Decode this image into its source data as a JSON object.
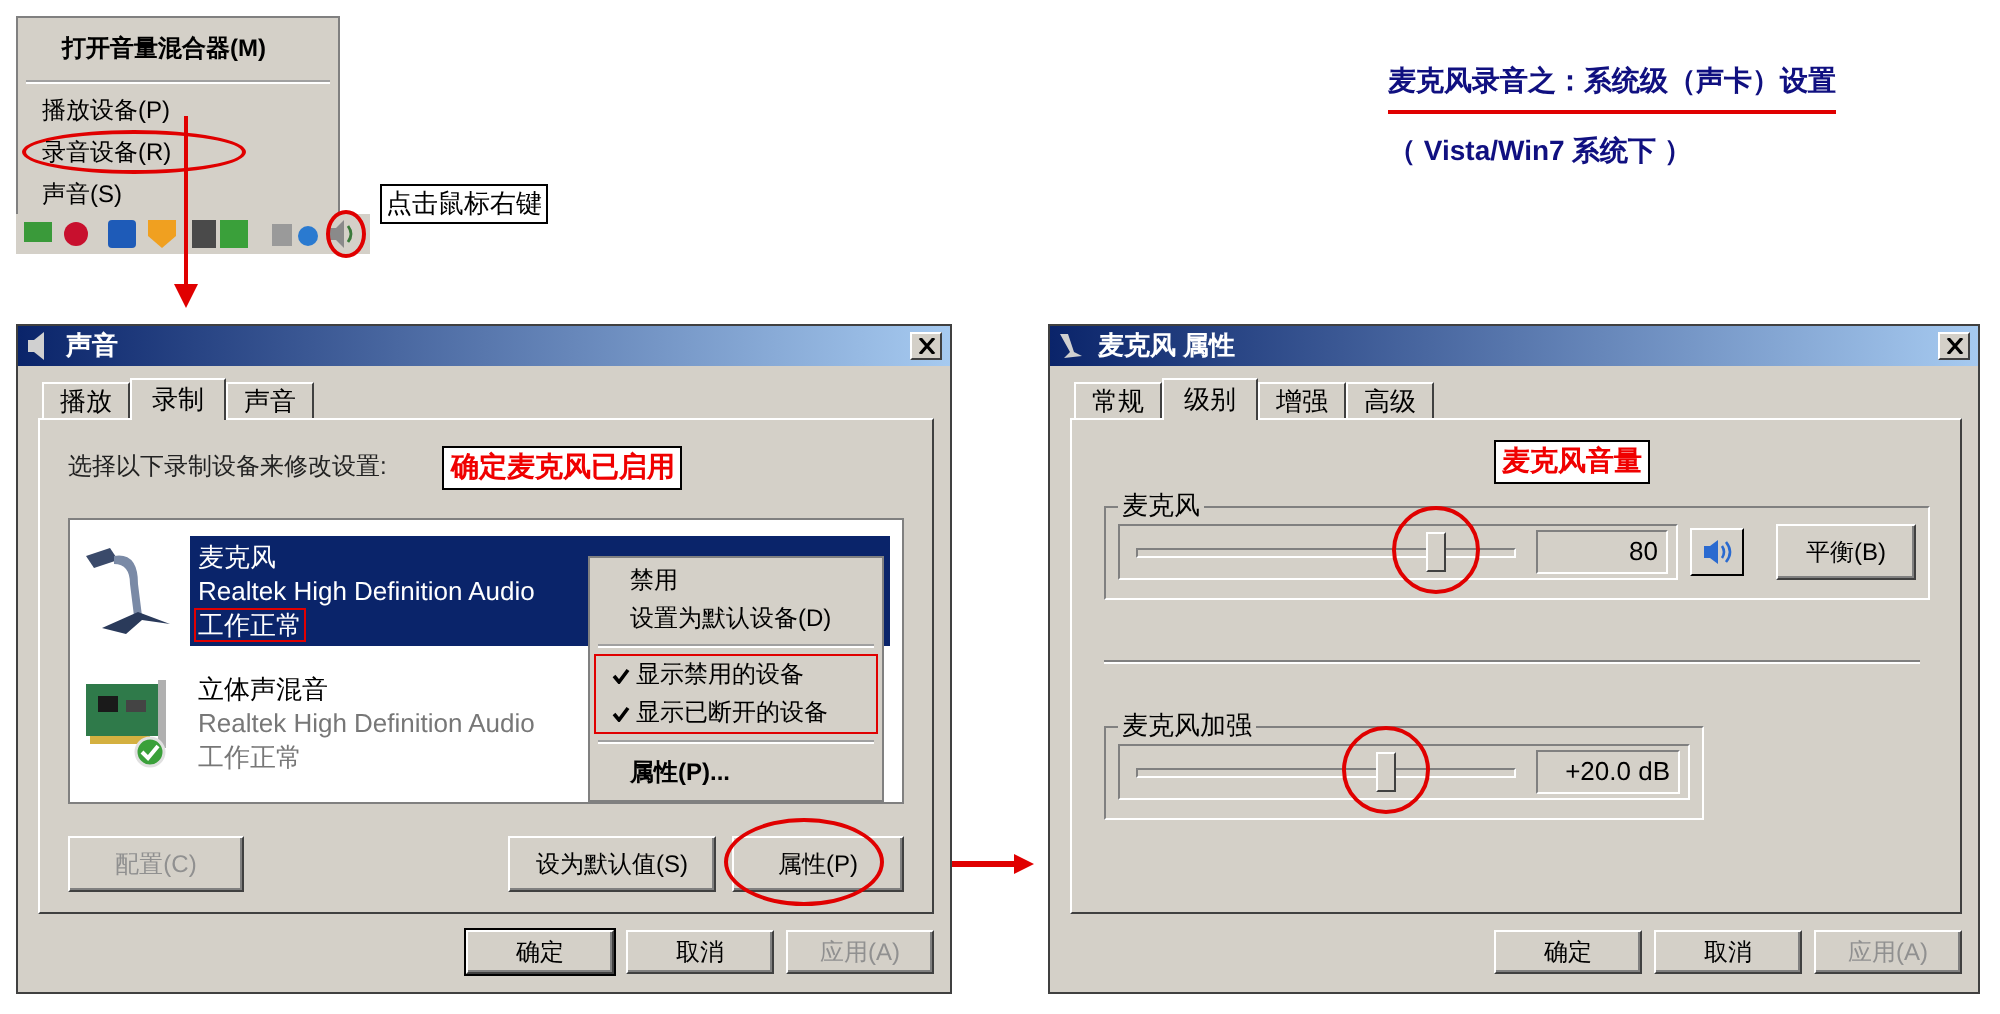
{
  "heading": {
    "title": "麦克风录音之：系统级（声卡）设置",
    "subtitle": "（ Vista/Win7 系统下 ）"
  },
  "tray": {
    "menu": [
      {
        "label": "打开音量混合器(M)",
        "kind": "header",
        "circled": false
      },
      {
        "label": "播放设备(P)",
        "kind": "item",
        "circled": false
      },
      {
        "label": "录音设备(R)",
        "kind": "item",
        "circled": true
      },
      {
        "label": "声音(S)",
        "kind": "item",
        "circled": false
      }
    ],
    "hint": "点击鼠标右键"
  },
  "sound_window": {
    "title": "声音",
    "tabs": [
      {
        "label": "播放",
        "selected": false
      },
      {
        "label": "录制",
        "selected": true
      },
      {
        "label": "声音",
        "selected": false
      }
    ],
    "instruction": "选择以下录制设备来修改设置:",
    "callout": "确定麦克风已启用",
    "devices": [
      {
        "kind": "microphone",
        "name": "麦克风",
        "driver": "Realtek High Definition Audio",
        "status": "工作正常",
        "selected": true,
        "status_boxed": true
      },
      {
        "kind": "sound-card",
        "name": "立体声混音",
        "driver": "Realtek High Definition Audio",
        "status": "工作正常",
        "selected": false,
        "status_boxed": false
      }
    ],
    "context_menu": {
      "items": [
        {
          "label": "禁用"
        },
        {
          "label": "设置为默认设备(D)"
        }
      ],
      "checks": {
        "boxed": true,
        "items": [
          {
            "label": "显示禁用的设备",
            "checked": true
          },
          {
            "label": "显示已断开的设备",
            "checked": true
          }
        ]
      },
      "last": {
        "label": "属性(P)..."
      }
    },
    "buttons": [
      {
        "label": "配置(C)",
        "disabled": true,
        "circled": false
      },
      {
        "label": "设为默认值(S)",
        "disabled": false,
        "circled": false
      },
      {
        "label": "属性(P)",
        "disabled": false,
        "circled": true
      }
    ],
    "footer": [
      {
        "label": "确定",
        "default": true,
        "disabled": false
      },
      {
        "label": "取消",
        "default": false,
        "disabled": false
      },
      {
        "label": "应用(A)",
        "default": false,
        "disabled": true
      }
    ]
  },
  "properties_window": {
    "title": "麦克风 属性",
    "tabs": [
      {
        "label": "常规",
        "selected": false
      },
      {
        "label": "级别",
        "selected": true
      },
      {
        "label": "增强",
        "selected": false
      },
      {
        "label": "高级",
        "selected": false
      }
    ],
    "callout": "麦克风音量",
    "controls": [
      {
        "kind": "volume",
        "label": "麦克风",
        "level": 0.79,
        "circled": true,
        "reading": "80",
        "balance_button": "平衡(B)"
      },
      {
        "kind": "boost",
        "label": "麦克风加强",
        "level": 0.66,
        "circled": true,
        "reading": "+20.0 dB"
      }
    ],
    "footer": [
      {
        "label": "确定",
        "default": false,
        "disabled": false
      },
      {
        "label": "取消",
        "default": false,
        "disabled": false
      },
      {
        "label": "应用(A)",
        "default": false,
        "disabled": true
      }
    ]
  }
}
